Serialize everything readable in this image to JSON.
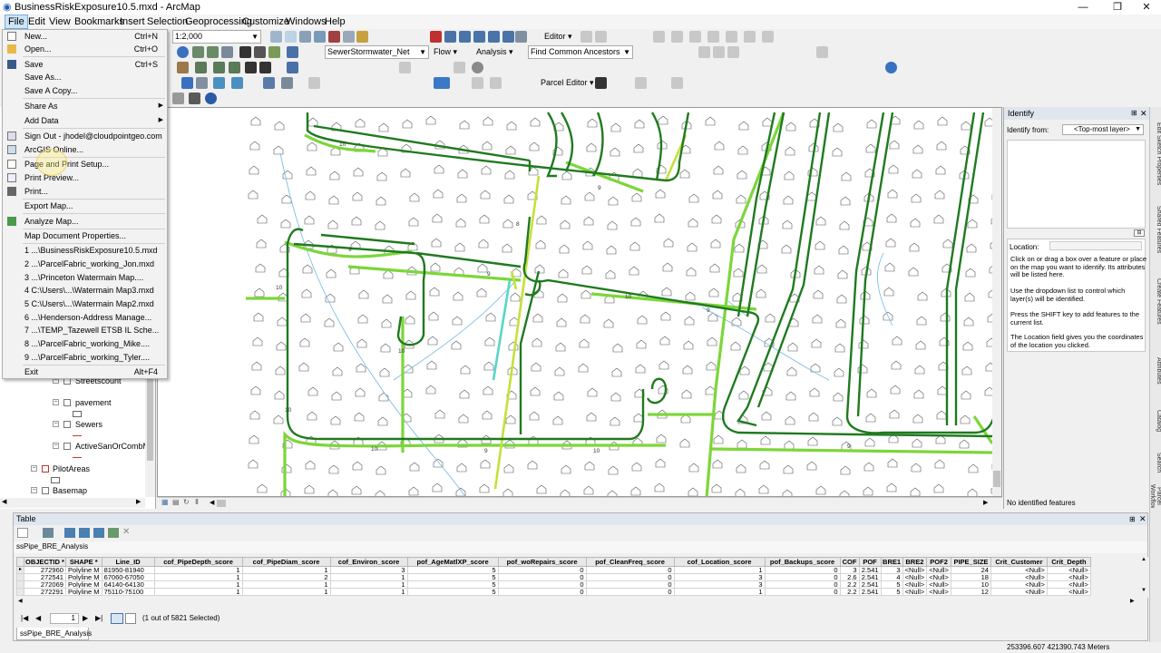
{
  "window": {
    "title": "BusinessRiskExposure10.5.mxd - ArcMap"
  },
  "menubar": [
    "File",
    "Edit",
    "View",
    "Bookmarks",
    "Insert",
    "Selection",
    "Geoprocessing",
    "Customize",
    "Windows",
    "Help"
  ],
  "toolbar": {
    "scale": "1:2,000",
    "editor": "Editor ▾",
    "network": "SewerStormwater_Net",
    "flow": "Flow ▾",
    "analysis": "Analysis ▾",
    "trace_task": "Find Common Ancestors",
    "parcel_editor": "Parcel Editor ▾"
  },
  "file_menu": {
    "items": [
      {
        "label": "New...",
        "shortcut": "Ctrl+N",
        "icon": "new-document-icon"
      },
      {
        "label": "Open...",
        "shortcut": "Ctrl+O",
        "icon": "open-folder-icon"
      },
      {
        "label": "Save",
        "shortcut": "Ctrl+S",
        "icon": "save-icon"
      },
      {
        "label": "Save As...",
        "shortcut": ""
      },
      {
        "label": "Save A Copy...",
        "shortcut": ""
      },
      {
        "label": "Share As",
        "shortcut": "",
        "submenu": true
      },
      {
        "label": "Add Data",
        "shortcut": "",
        "submenu": true
      },
      {
        "label": "Sign Out - jhodel@cloudpointgeo.com",
        "shortcut": "",
        "icon": "sign-out-icon"
      },
      {
        "label": "ArcGIS Online...",
        "shortcut": "",
        "icon": "arcgis-online-icon"
      },
      {
        "label": "Page and Print Setup...",
        "shortcut": "",
        "icon": "page-setup-icon"
      },
      {
        "label": "Print Preview...",
        "shortcut": "",
        "icon": "print-preview-icon"
      },
      {
        "label": "Print...",
        "shortcut": "",
        "icon": "print-icon"
      },
      {
        "label": "Export Map...",
        "shortcut": ""
      },
      {
        "label": "Analyze Map...",
        "shortcut": "",
        "icon": "analyze-map-icon"
      },
      {
        "label": "Map Document Properties...",
        "shortcut": ""
      },
      {
        "label": "1 ...\\BusinessRiskExposure10.5.mxd",
        "shortcut": ""
      },
      {
        "label": "2 ...\\ParcelFabric_working_Jon.mxd",
        "shortcut": ""
      },
      {
        "label": "3 ...\\Princeton Watermain Map....",
        "shortcut": ""
      },
      {
        "label": "4 C:\\Users\\...\\Watermain Map3.mxd",
        "shortcut": ""
      },
      {
        "label": "5 C:\\Users\\...\\Watermain Map2.mxd",
        "shortcut": ""
      },
      {
        "label": "6 ...\\Henderson-Address Manage...",
        "shortcut": ""
      },
      {
        "label": "7 ...\\TEMP_Tazewell ETSB IL Sche...",
        "shortcut": ""
      },
      {
        "label": "8 ...\\ParcelFabric_working_Mike....",
        "shortcut": ""
      },
      {
        "label": "9 ...\\ParcelFabric_working_Tyler....",
        "shortcut": ""
      },
      {
        "label": "Exit",
        "shortcut": "Alt+F4"
      }
    ]
  },
  "toc": {
    "layers": [
      {
        "label": "Streetscount",
        "indent": 2
      },
      {
        "label": "pavement",
        "indent": 2
      },
      {
        "label": "Sewers",
        "indent": 2
      },
      {
        "label": "ActiveSanOrCombMa",
        "indent": 2
      },
      {
        "label": "PilotAreas",
        "indent": 1
      },
      {
        "label": "Basemap",
        "indent": 1
      }
    ]
  },
  "map": {
    "labels": [
      "10",
      "10",
      "9",
      "9",
      "9",
      "10",
      "9",
      "10",
      "10",
      "10",
      "9",
      "10",
      "9",
      "8"
    ]
  },
  "identify": {
    "title": "Identify",
    "identify_from_label": "Identify from:",
    "identify_from_value": "<Top-most layer>",
    "location_label": "Location:",
    "help": [
      "Click on or drag a box over a feature or place on the map you want to identify. Its attributes will be listed here.",
      "Use the dropdown list to control which layer(s) will be identified.",
      "Press the SHIFT key to add features to the current list.",
      "The Location field gives you the coordinates of the location you clicked."
    ],
    "status": "No identified features"
  },
  "side_tabs": [
    "Edit Sketch Properties",
    "Shared Features",
    "Create Features",
    "Attributes",
    "Catalog",
    "Search",
    "Parcel Workflows"
  ],
  "table": {
    "title": "Table",
    "tab_name": "ssPipe_BRE_Analysis",
    "columns": [
      "OBJECTID *",
      "SHAPE *",
      "Line_ID",
      "cof_PipeDepth_score",
      "cof_PipeDiam_score",
      "cof_Environ_score",
      "pof_AgeMatlXP_score",
      "pof_woRepairs_score",
      "pof_CleanFreq_score",
      "cof_Location_score",
      "pof_Backups_score",
      "COF",
      "POF",
      "BRE1",
      "BRE2",
      "POF2",
      "PIPE_SIZE",
      "Crit_Customer",
      "Crit_Depth"
    ],
    "rows": [
      [
        "272960",
        "Polyline M",
        "81950-81940",
        "1",
        "1",
        "3",
        "5",
        "0",
        "0",
        "1",
        "0",
        "3",
        "2.541",
        "3",
        "<Null>",
        "<Null>",
        "24",
        "<Null>",
        "<Null>"
      ],
      [
        "272541",
        "Polyline M",
        "67060-67050",
        "1",
        "2",
        "1",
        "5",
        "0",
        "0",
        "3",
        "0",
        "2.6",
        "2.541",
        "4",
        "<Null>",
        "<Null>",
        "18",
        "<Null>",
        "<Null>"
      ],
      [
        "272069",
        "Polyline M",
        "64140-64130",
        "1",
        "1",
        "1",
        "5",
        "0",
        "0",
        "3",
        "0",
        "2.2",
        "2.541",
        "5",
        "<Null>",
        "<Null>",
        "10",
        "<Null>",
        "<Null>"
      ],
      [
        "272291",
        "Polyline M",
        "75110-75100",
        "1",
        "1",
        "1",
        "5",
        "0",
        "0",
        "1",
        "0",
        "2.2",
        "2.541",
        "5",
        "<Null>",
        "<Null>",
        "12",
        "<Null>",
        "<Null>"
      ]
    ],
    "record_number": "1",
    "selection_status": "(1 out of 5821 Selected)"
  },
  "statusbar": {
    "coordinates": "253396.607  421390.743 Meters"
  },
  "colors": {
    "dark_green": "#1f7a1f",
    "light_green": "#7cd63a",
    "yellow_green": "#c5e03a",
    "cyan": "#56d6c8",
    "thin_blue": "#6fb8e0",
    "parcel": "#444444"
  }
}
